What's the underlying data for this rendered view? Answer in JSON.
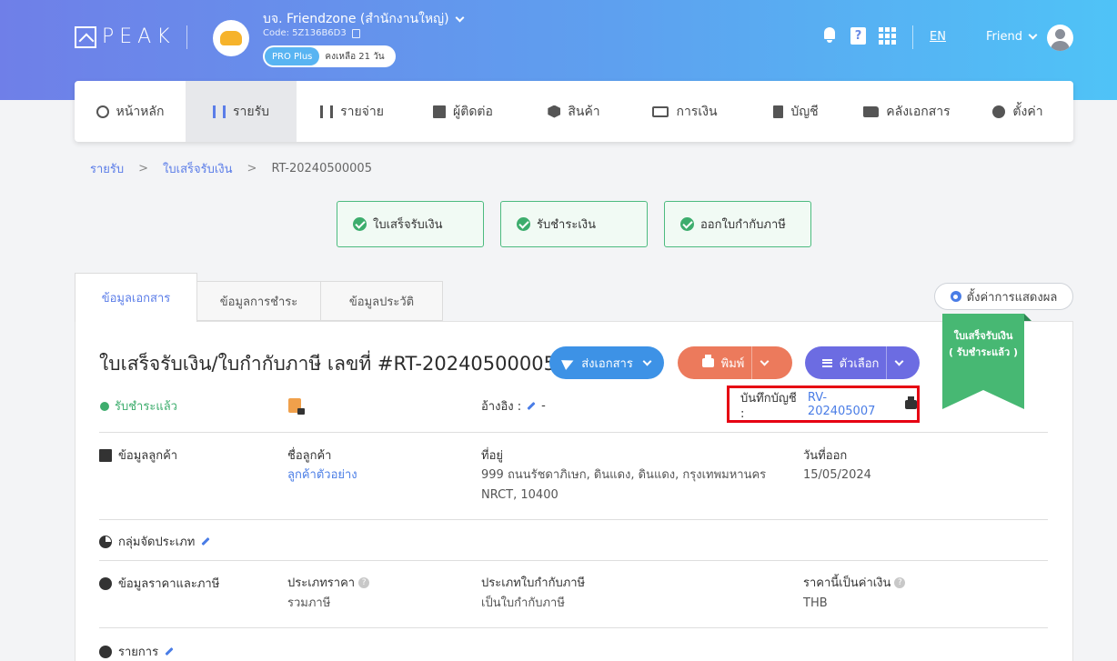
{
  "header": {
    "logo": "PEAK",
    "company_name": "บจ. Friendzone (สำนักงานใหญ่)",
    "company_code": "Code: 5Z136B6D3",
    "plan_badge": "PRO Plus",
    "plan_remaining": "คงเหลือ 21 วัน",
    "language": "EN",
    "user_name": "Friend"
  },
  "nav": [
    {
      "label": "หน้าหลัก",
      "icon": "dashboard-icon"
    },
    {
      "label": "รายรับ",
      "icon": "income-icon",
      "active": true
    },
    {
      "label": "รายจ่าย",
      "icon": "expense-icon"
    },
    {
      "label": "ผู้ติดต่อ",
      "icon": "contacts-icon"
    },
    {
      "label": "สินค้า",
      "icon": "product-icon"
    },
    {
      "label": "การเงิน",
      "icon": "money-icon"
    },
    {
      "label": "บัญชี",
      "icon": "book-icon"
    },
    {
      "label": "คลังเอกสาร",
      "icon": "folder-icon"
    },
    {
      "label": "ตั้งค่า",
      "icon": "gear-icon"
    }
  ],
  "breadcrumb": {
    "level1": "รายรับ",
    "level2": "ใบเสร็จรับเงิน",
    "current": "RT-20240500005",
    "separator": ">"
  },
  "steps": [
    "ใบเสร็จรับเงิน",
    "รับชำระเงิน",
    "ออกใบกำกับภาษี"
  ],
  "tabs": [
    "ข้อมูลเอกสาร",
    "ข้อมูลการชำระ",
    "ข้อมูลประวัติ"
  ],
  "display_settings": "ตั้งค่าการแสดงผล",
  "document": {
    "title": "ใบเสร็จรับเงิน/ใบกำกับภาษี เลขที่ #RT-20240500005",
    "send_label": "ส่งเอกสาร",
    "print_label": "พิมพ์",
    "options_label": "ตัวเลือก",
    "ribbon_line1": "ใบเสร็จรับเงิน",
    "ribbon_line2": "( รับชำระแล้ว )",
    "status": "รับชำระแล้ว",
    "reference_label": "อ้างอิง :",
    "reference_value": "-",
    "record_label": "บันทึกบัญชี :",
    "record_value": "RV-202405007"
  },
  "customer_section": {
    "heading": "ข้อมูลลูกค้า",
    "name_label": "ชื่อลูกค้า",
    "name_value": "ลูกค้าตัวอย่าง",
    "address_label": "ที่อยู่",
    "address_line1": "999 ถนนรัชดาภิเษก, ดินแดง, ดินแดง, กรุงเทพมหานคร",
    "address_line2": "NRCT, 10400",
    "date_label": "วันที่ออก",
    "date_value": "15/05/2024"
  },
  "group_section": {
    "heading": "กลุ่มจัดประเภท"
  },
  "price_section": {
    "heading": "ข้อมูลราคาและภาษี",
    "price_type_label": "ประเภทราคา",
    "price_type_value": "รวมภาษี",
    "tax_invoice_label": "ประเภทใบกำกับภาษี",
    "tax_invoice_value": "เป็นใบกำกับภาษี",
    "currency_label": "ราคานี้เป็นค่าเงิน",
    "currency_value": "THB"
  },
  "items_section": {
    "heading": "รายการ"
  },
  "colors": {
    "accent": "#5b7de8",
    "success": "#3dad6d",
    "send": "#3d92e6",
    "print": "#ec7a5c",
    "options": "#6c6ce2",
    "highlight": "#e60012"
  }
}
